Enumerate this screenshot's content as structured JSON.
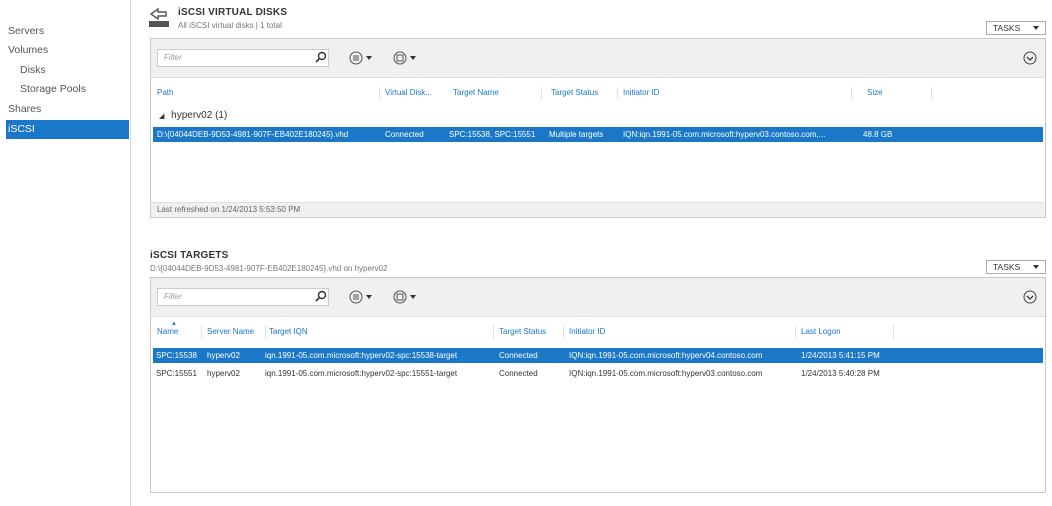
{
  "sidebar": {
    "items": [
      {
        "label": "Servers"
      },
      {
        "label": "Volumes"
      },
      {
        "label": "Disks"
      },
      {
        "label": "Storage Pools"
      },
      {
        "label": "Shares"
      },
      {
        "label": "iSCSI"
      }
    ]
  },
  "disks": {
    "title": "iSCSI VIRTUAL DISKS",
    "subtitle": "All iSCSI virtual disks | 1 total",
    "tasks_label": "TASKS",
    "filter_placeholder": "Filter",
    "columns": [
      "Path",
      "Virtual Disk...",
      "Target Name",
      "Target Status",
      "Initiator ID",
      "Size"
    ],
    "group_label": "hyperv02 (1)",
    "rows": [
      {
        "path": "D:\\{04044DEB-9D53-4981-907F-EB402E180245}.vhd",
        "status": "Connected",
        "target_name": "SPC:15538, SPC:15551",
        "target_status": "Multiple targets",
        "initiator_id": "IQN:iqn.1991-05.com.microsoft:hyperv03.contoso.com,...",
        "size": "48.8 GB"
      }
    ],
    "footer": "Last refreshed on 1/24/2013 5:53:50 PM"
  },
  "targets": {
    "title": "iSCSI TARGETS",
    "subtitle": "D:\\{04044DEB-9D53-4981-907F-EB402E180245}.vhd on hyperv02",
    "tasks_label": "TASKS",
    "filter_placeholder": "Filter",
    "columns": [
      "Name",
      "Server Name",
      "Target IQN",
      "Target Status",
      "Initiator ID",
      "Last Logon"
    ],
    "rows": [
      {
        "name": "SPC:15538",
        "server": "hyperv02",
        "iqn": "iqn.1991-05.com.microsoft:hyperv02-spc:15538-target",
        "status": "Connected",
        "initiator": "IQN:iqn.1991-05.com.microsoft:hyperv04.contoso.com",
        "last_logon": "1/24/2013 5:41:15 PM"
      },
      {
        "name": "SPC:15551",
        "server": "hyperv02",
        "iqn": "iqn.1991-05.com.microsoft:hyperv02-spc:15551-target",
        "status": "Connected",
        "initiator": "IQN:iqn.1991-05.com.microsoft:hyperv03.contoso.com",
        "last_logon": "1/24/2013 5:40:28 PM"
      }
    ]
  },
  "colors": {
    "accent": "#1b78c8",
    "toolbar": "#f0f0f0"
  }
}
